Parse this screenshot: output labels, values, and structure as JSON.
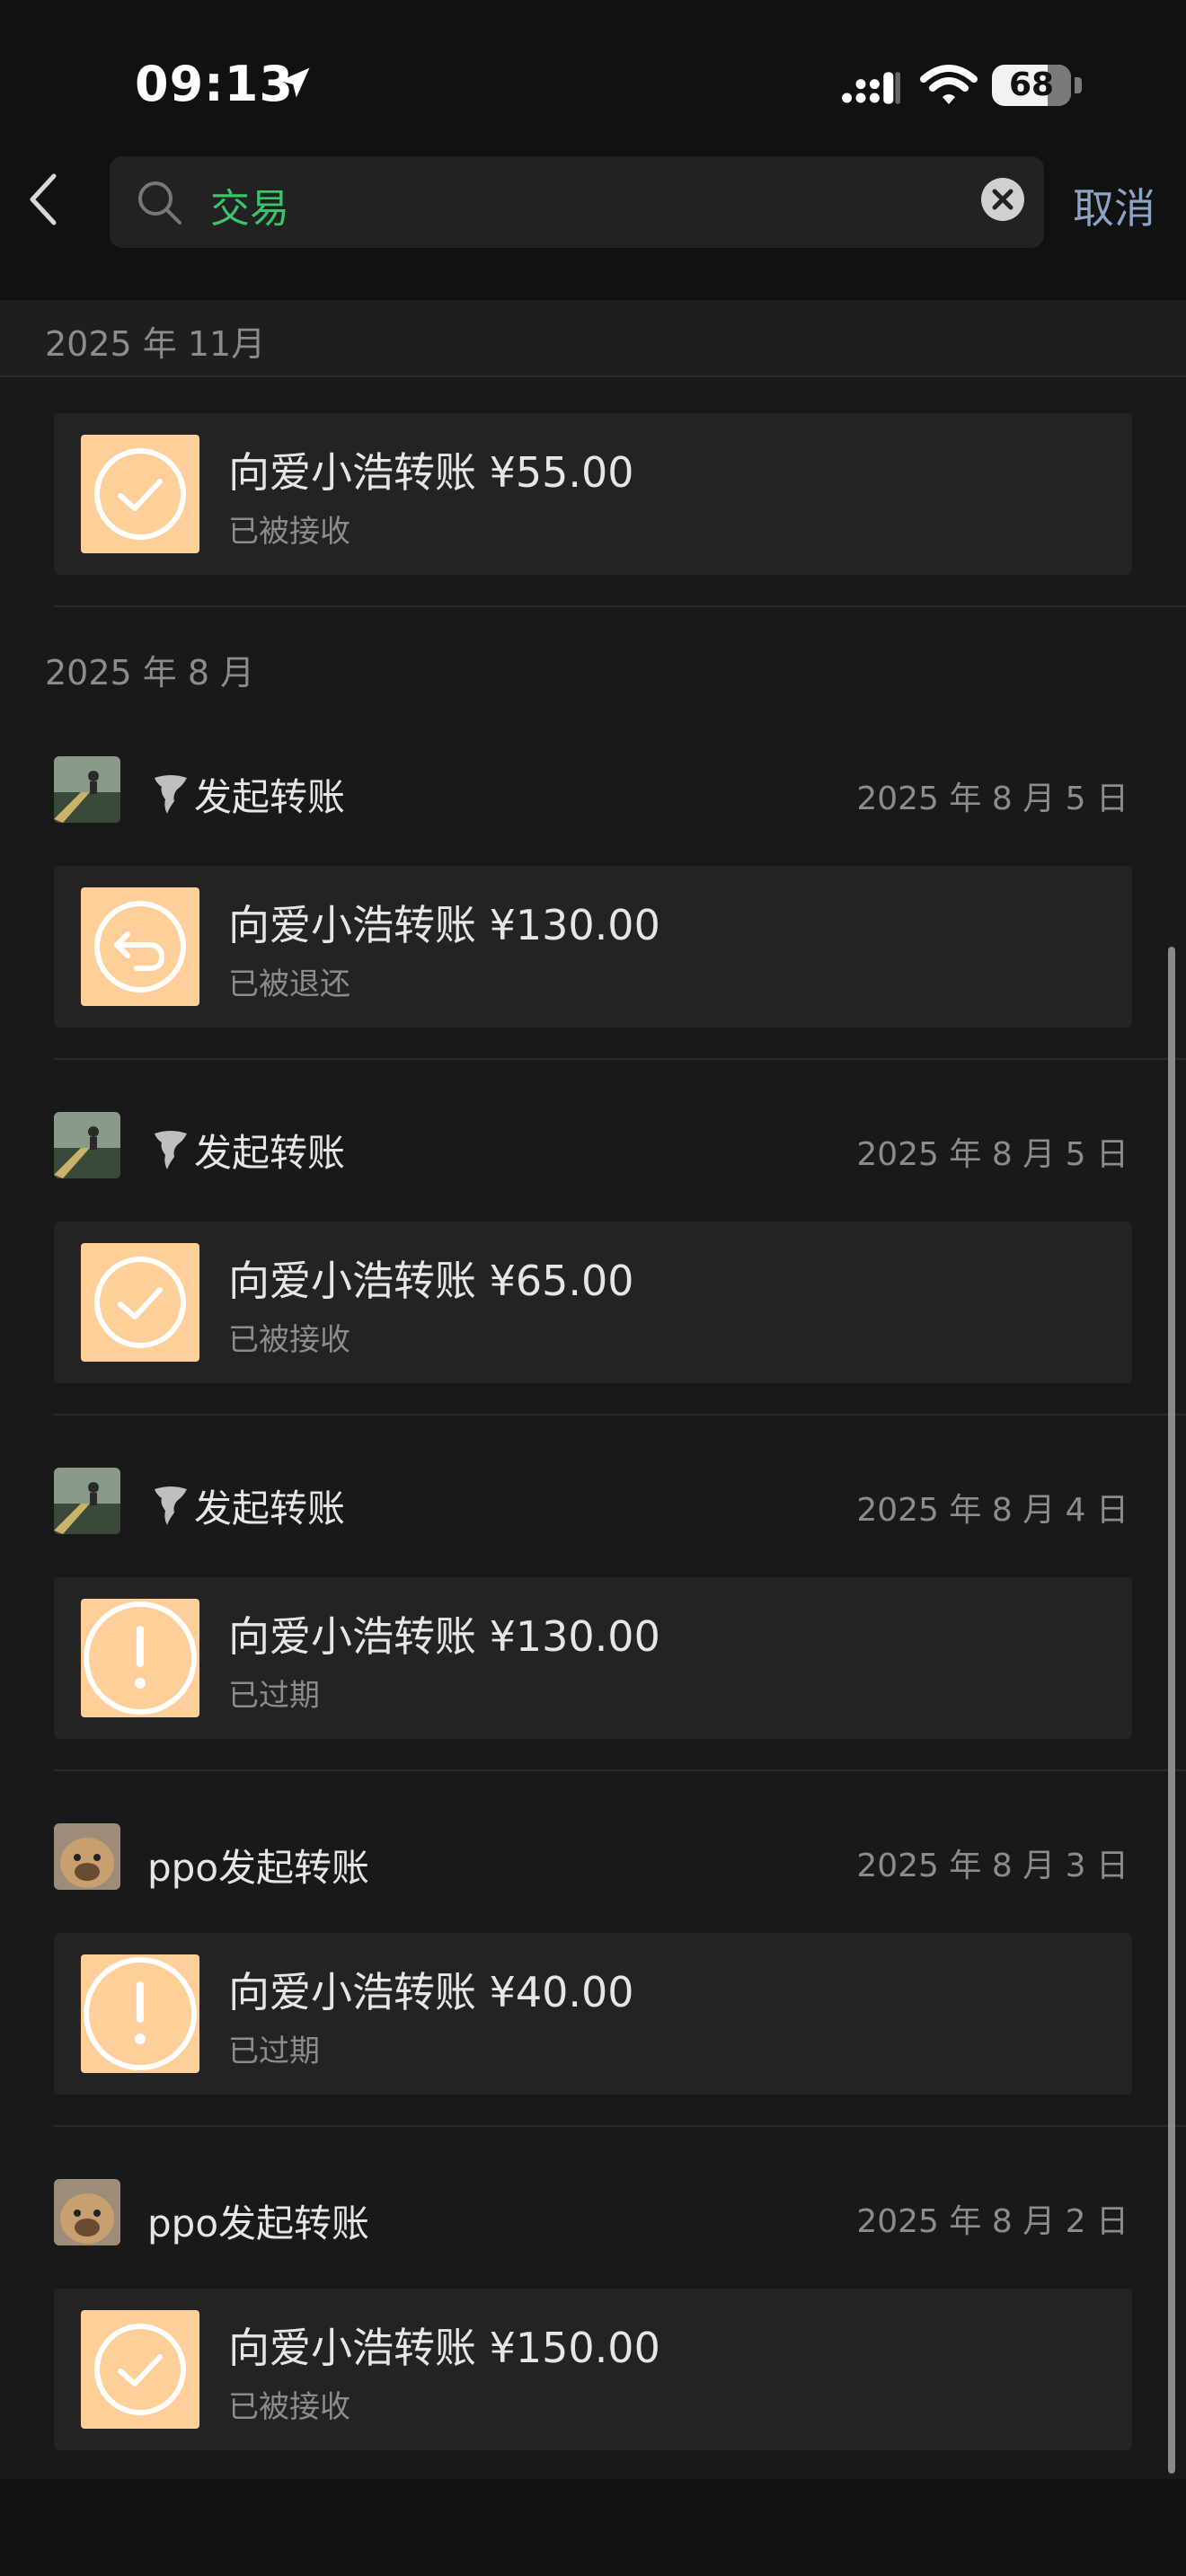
{
  "status_bar": {
    "time": "09:13",
    "battery": "68"
  },
  "header": {
    "search_query": "交易",
    "cancel_label": "取消"
  },
  "sections": [
    {
      "month": "2025 年 11月"
    },
    {
      "month": "2025 年 8 月"
    }
  ],
  "top_card": {
    "title": "向爱小浩转账 ¥55.00",
    "status": "已被接收",
    "icon": "check-icon"
  },
  "records": [
    {
      "sender": "发起转账",
      "date": "2025 年 8 月 5 日",
      "title": "向爱小浩转账 ¥130.00",
      "status": "已被退还",
      "icon": "return-icon"
    },
    {
      "sender": "发起转账",
      "date": "2025 年 8 月 5 日",
      "title": "向爱小浩转账 ¥65.00",
      "status": "已被接收",
      "icon": "check-icon"
    },
    {
      "sender": "发起转账",
      "date": "2025 年 8 月 4 日",
      "title": "向爱小浩转账 ¥130.00",
      "status": "已过期",
      "icon": "exclamation-icon"
    },
    {
      "sender": "ppo发起转账",
      "date": "2025 年 8 月 3 日",
      "title": "向爱小浩转账 ¥40.00",
      "status": "已过期",
      "icon": "exclamation-icon"
    },
    {
      "sender": "ppo发起转账",
      "date": "2025 年 8 月 2 日",
      "title": "向爱小浩转账 ¥150.00",
      "status": "已被接收",
      "icon": "check-icon"
    }
  ],
  "colors": {
    "accent_green": "#3cc46a",
    "card_icon_bg": "#ffcf99",
    "link_blue": "#8fa3c7"
  }
}
